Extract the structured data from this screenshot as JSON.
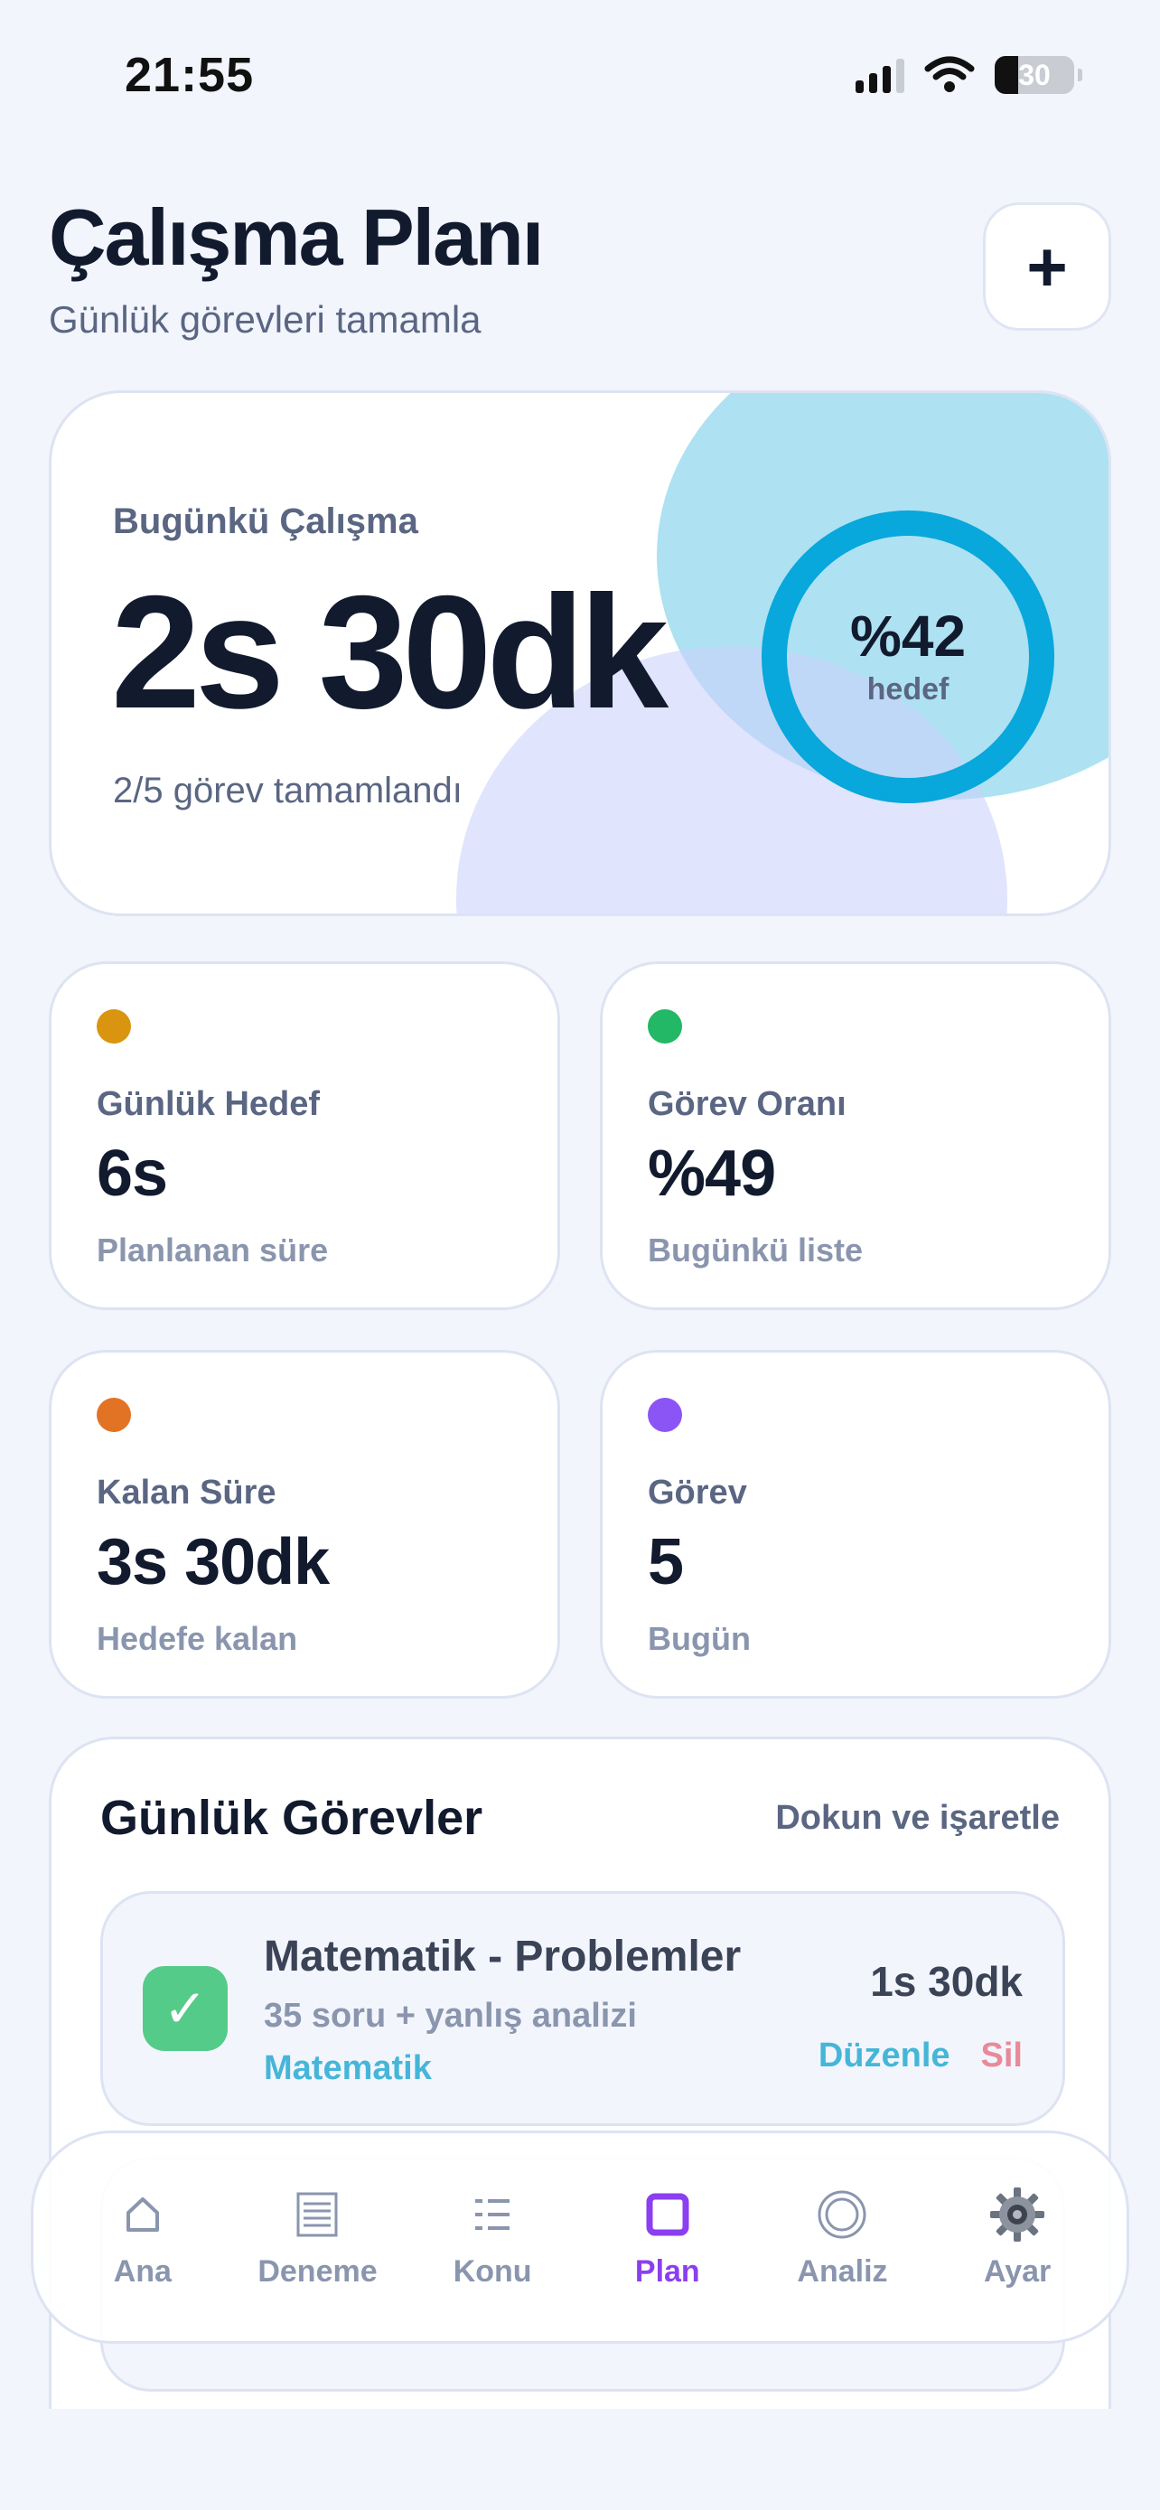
{
  "status_bar": {
    "time": "21:55",
    "battery": "30"
  },
  "header": {
    "title": "Çalışma Planı",
    "subtitle": "Günlük görevleri tamamla",
    "add_label": "+"
  },
  "hero": {
    "label": "Bugünkü Çalışma",
    "value": "2s 30dk",
    "subtitle": "2/5 görev tamamlandı",
    "ring_value": "%42",
    "ring_label": "hedef",
    "ring_progress": 0.42,
    "ring_color": "#08a7dc"
  },
  "stats": [
    {
      "label": "Günlük Hedef",
      "value": "6s",
      "sub": "Planlanan süre",
      "color": "#d9950f"
    },
    {
      "label": "Görev Oranı",
      "value": "%49",
      "sub": "Bugünkü liste",
      "color": "#22b865"
    },
    {
      "label": "Kalan Süre",
      "value": "3s 30dk",
      "sub": "Hedefe kalan",
      "color": "#e27324"
    },
    {
      "label": "Görev",
      "value": "5",
      "sub": "Bugün",
      "color": "#8b55f6"
    }
  ],
  "tasks": {
    "title": "Günlük Görevler",
    "hint": "Dokun ve işaretle",
    "items": [
      {
        "title": "Matematik - Problemler",
        "description": "35 soru + yanlış analizi",
        "subject": "Matematik",
        "time": "1s 30dk",
        "edit_label": "Düzenle",
        "delete_label": "Sil",
        "done": true
      }
    ]
  },
  "tab_bar": {
    "tabs": [
      {
        "label": "Ana",
        "icon": "home-icon"
      },
      {
        "label": "Deneme",
        "icon": "document-icon"
      },
      {
        "label": "Konu",
        "icon": "list-icon"
      },
      {
        "label": "Plan",
        "icon": "square-icon",
        "active": true
      },
      {
        "label": "Analiz",
        "icon": "target-icon"
      },
      {
        "label": "Ayar",
        "icon": "gear-icon"
      }
    ],
    "active_color": "#8b3ff0"
  }
}
